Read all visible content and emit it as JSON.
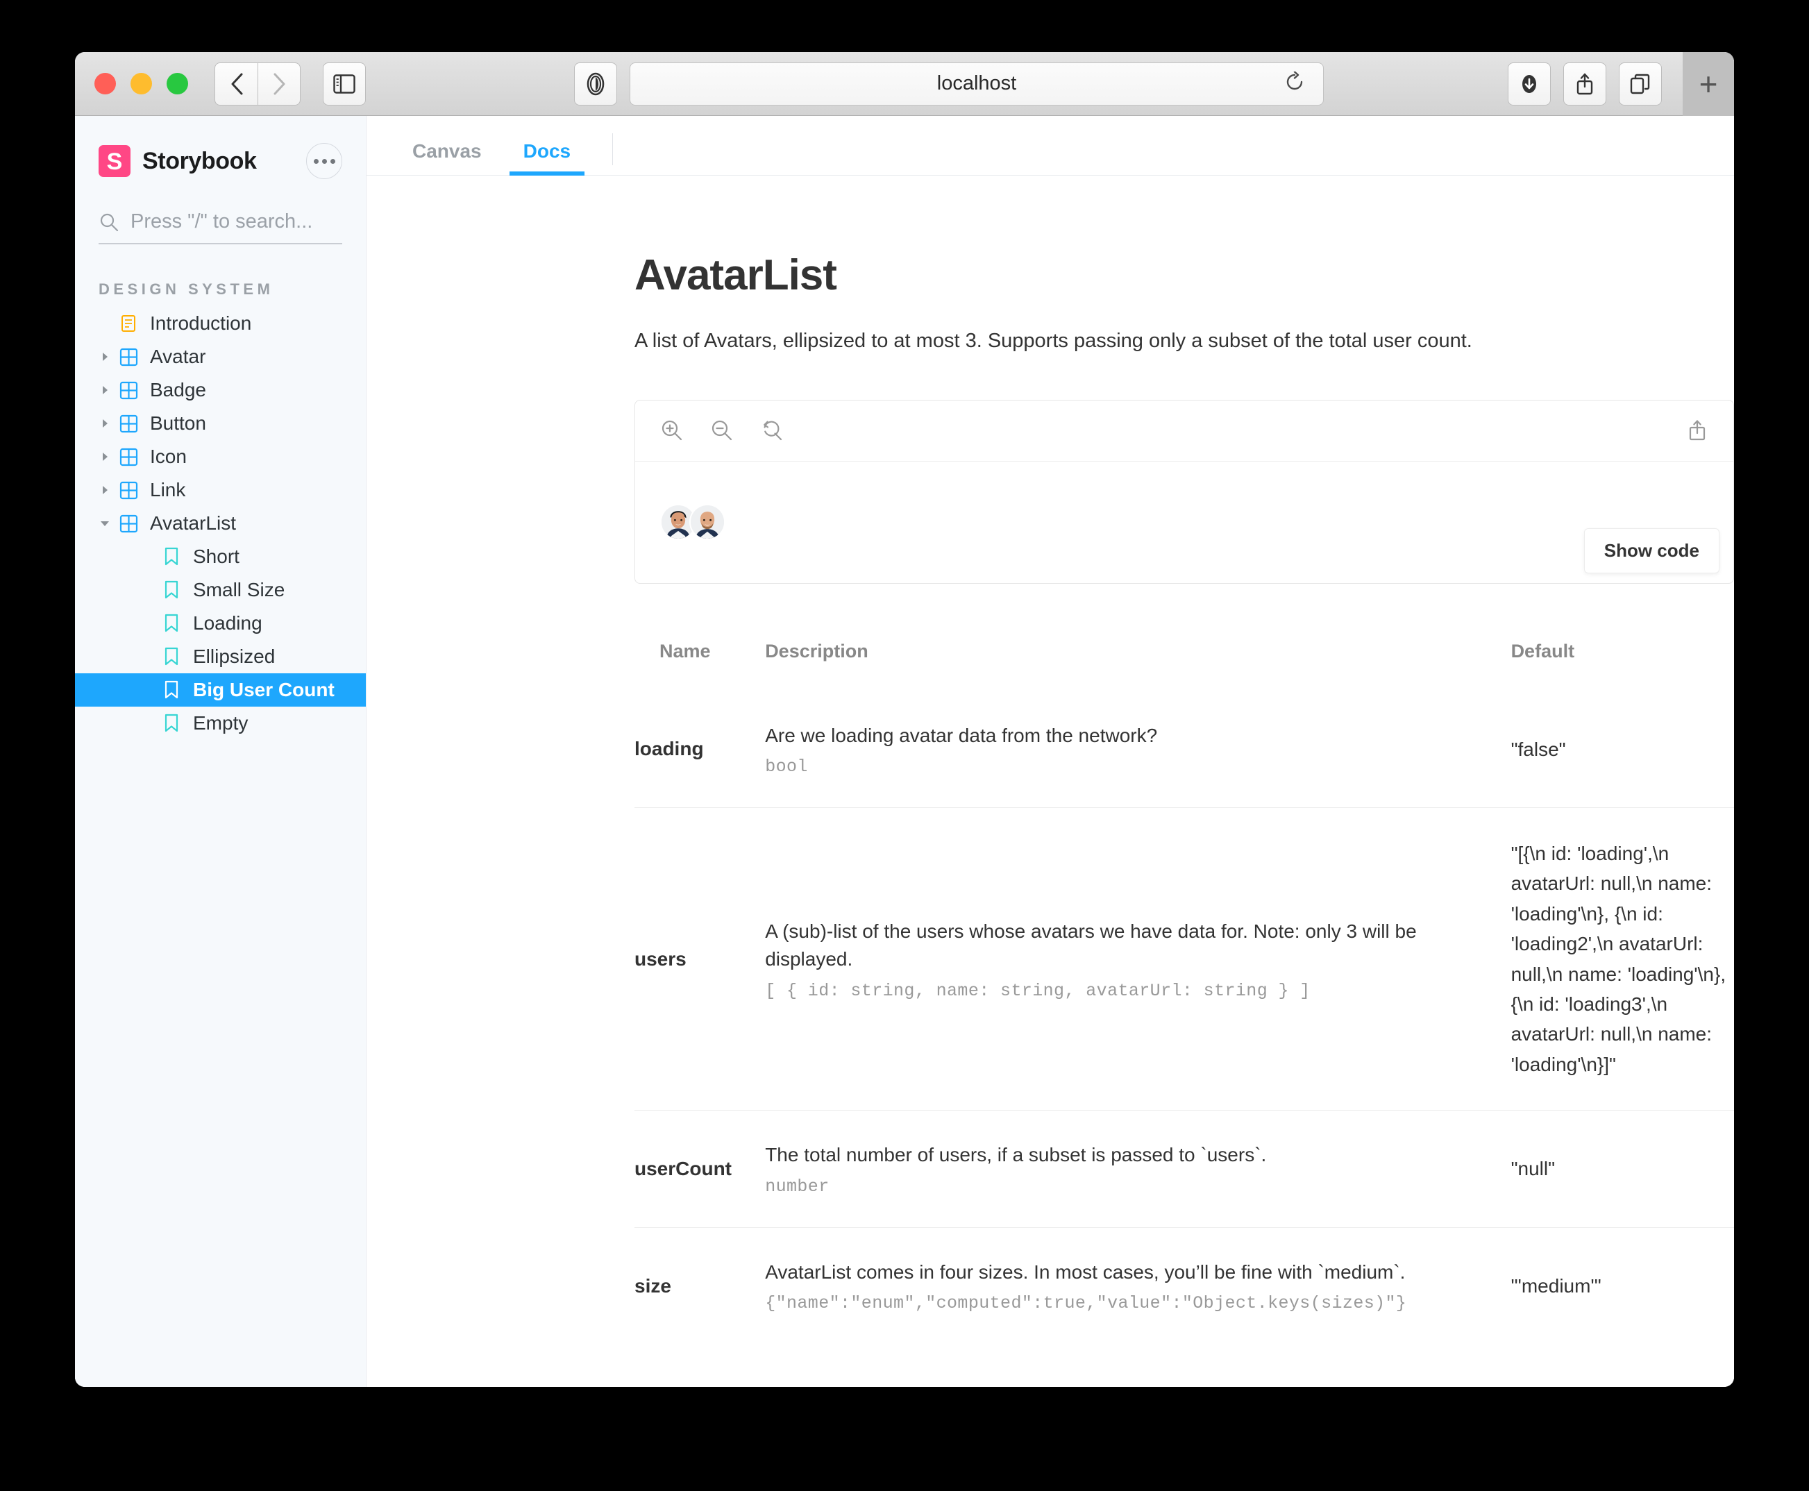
{
  "browser": {
    "url": "localhost",
    "traffic_lights": [
      "close",
      "minimize",
      "maximize"
    ],
    "back_label": "‹",
    "forward_label": "›",
    "newtab_label": "+"
  },
  "sidebar": {
    "brand": "Storybook",
    "logo_letter": "S",
    "search_placeholder": "Press \"/\" to search...",
    "section_title": "DESIGN SYSTEM",
    "items": [
      {
        "label": "Introduction",
        "icon": "document-icon",
        "level": 1,
        "expandable": false,
        "expanded": false,
        "selected": false
      },
      {
        "label": "Avatar",
        "icon": "component-icon",
        "level": 1,
        "expandable": true,
        "expanded": false,
        "selected": false
      },
      {
        "label": "Badge",
        "icon": "component-icon",
        "level": 1,
        "expandable": true,
        "expanded": false,
        "selected": false
      },
      {
        "label": "Button",
        "icon": "component-icon",
        "level": 1,
        "expandable": true,
        "expanded": false,
        "selected": false
      },
      {
        "label": "Icon",
        "icon": "component-icon",
        "level": 1,
        "expandable": true,
        "expanded": false,
        "selected": false
      },
      {
        "label": "Link",
        "icon": "component-icon",
        "level": 1,
        "expandable": true,
        "expanded": false,
        "selected": false
      },
      {
        "label": "AvatarList",
        "icon": "component-icon",
        "level": 1,
        "expandable": true,
        "expanded": true,
        "selected": false
      },
      {
        "label": "Short",
        "icon": "story-icon",
        "level": 2,
        "expandable": false,
        "expanded": false,
        "selected": false
      },
      {
        "label": "Small Size",
        "icon": "story-icon",
        "level": 2,
        "expandable": false,
        "expanded": false,
        "selected": false
      },
      {
        "label": "Loading",
        "icon": "story-icon",
        "level": 2,
        "expandable": false,
        "expanded": false,
        "selected": false
      },
      {
        "label": "Ellipsized",
        "icon": "story-icon",
        "level": 2,
        "expandable": false,
        "expanded": false,
        "selected": false
      },
      {
        "label": "Big User Count",
        "icon": "story-icon",
        "level": 2,
        "expandable": false,
        "expanded": false,
        "selected": true
      },
      {
        "label": "Empty",
        "icon": "story-icon",
        "level": 2,
        "expandable": false,
        "expanded": false,
        "selected": false
      }
    ]
  },
  "tabs": [
    {
      "label": "Canvas",
      "active": false
    },
    {
      "label": "Docs",
      "active": true
    }
  ],
  "doc": {
    "title": "AvatarList",
    "description": "A list of Avatars, ellipsized to at most 3. Supports passing only a subset of the total user count.",
    "show_code_label": "Show code"
  },
  "props_table": {
    "headers": [
      "Name",
      "Description",
      "Default"
    ],
    "rows": [
      {
        "name": "loading",
        "description": "Are we loading avatar data from the network?",
        "type": "bool",
        "default": "\"false\""
      },
      {
        "name": "users",
        "description": "A (sub)-list of the users whose avatars we have data for. Note: only 3 will be displayed.",
        "type": "[ { id: string, name: string, avatarUrl: string } ]",
        "default": "\"[{\\n id: 'loading',\\n avatarUrl: null,\\n name: 'loading'\\n}, {\\n id: 'loading2',\\n avatarUrl: null,\\n name: 'loading'\\n}, {\\n id: 'loading3',\\n avatarUrl: null,\\n name: 'loading'\\n}]\""
      },
      {
        "name": "userCount",
        "description": "The total number of users, if a subset is passed to `users`.",
        "type": "number",
        "default": "\"null\""
      },
      {
        "name": "size",
        "description": "AvatarList comes in four sizes. In most cases, you’ll be fine with `medium`.",
        "type": "{\"name\":\"enum\",\"computed\":true,\"value\":\"Object.keys(sizes)\"}",
        "default": "\"'medium'\""
      }
    ]
  },
  "colors": {
    "accent": "#1ea7fd",
    "brand": "#ff4785",
    "sidebar_bg": "#f6f9fc",
    "story_icon": "#37d5d3",
    "component_icon": "#1ea7fd",
    "document_icon": "#ffae00"
  }
}
